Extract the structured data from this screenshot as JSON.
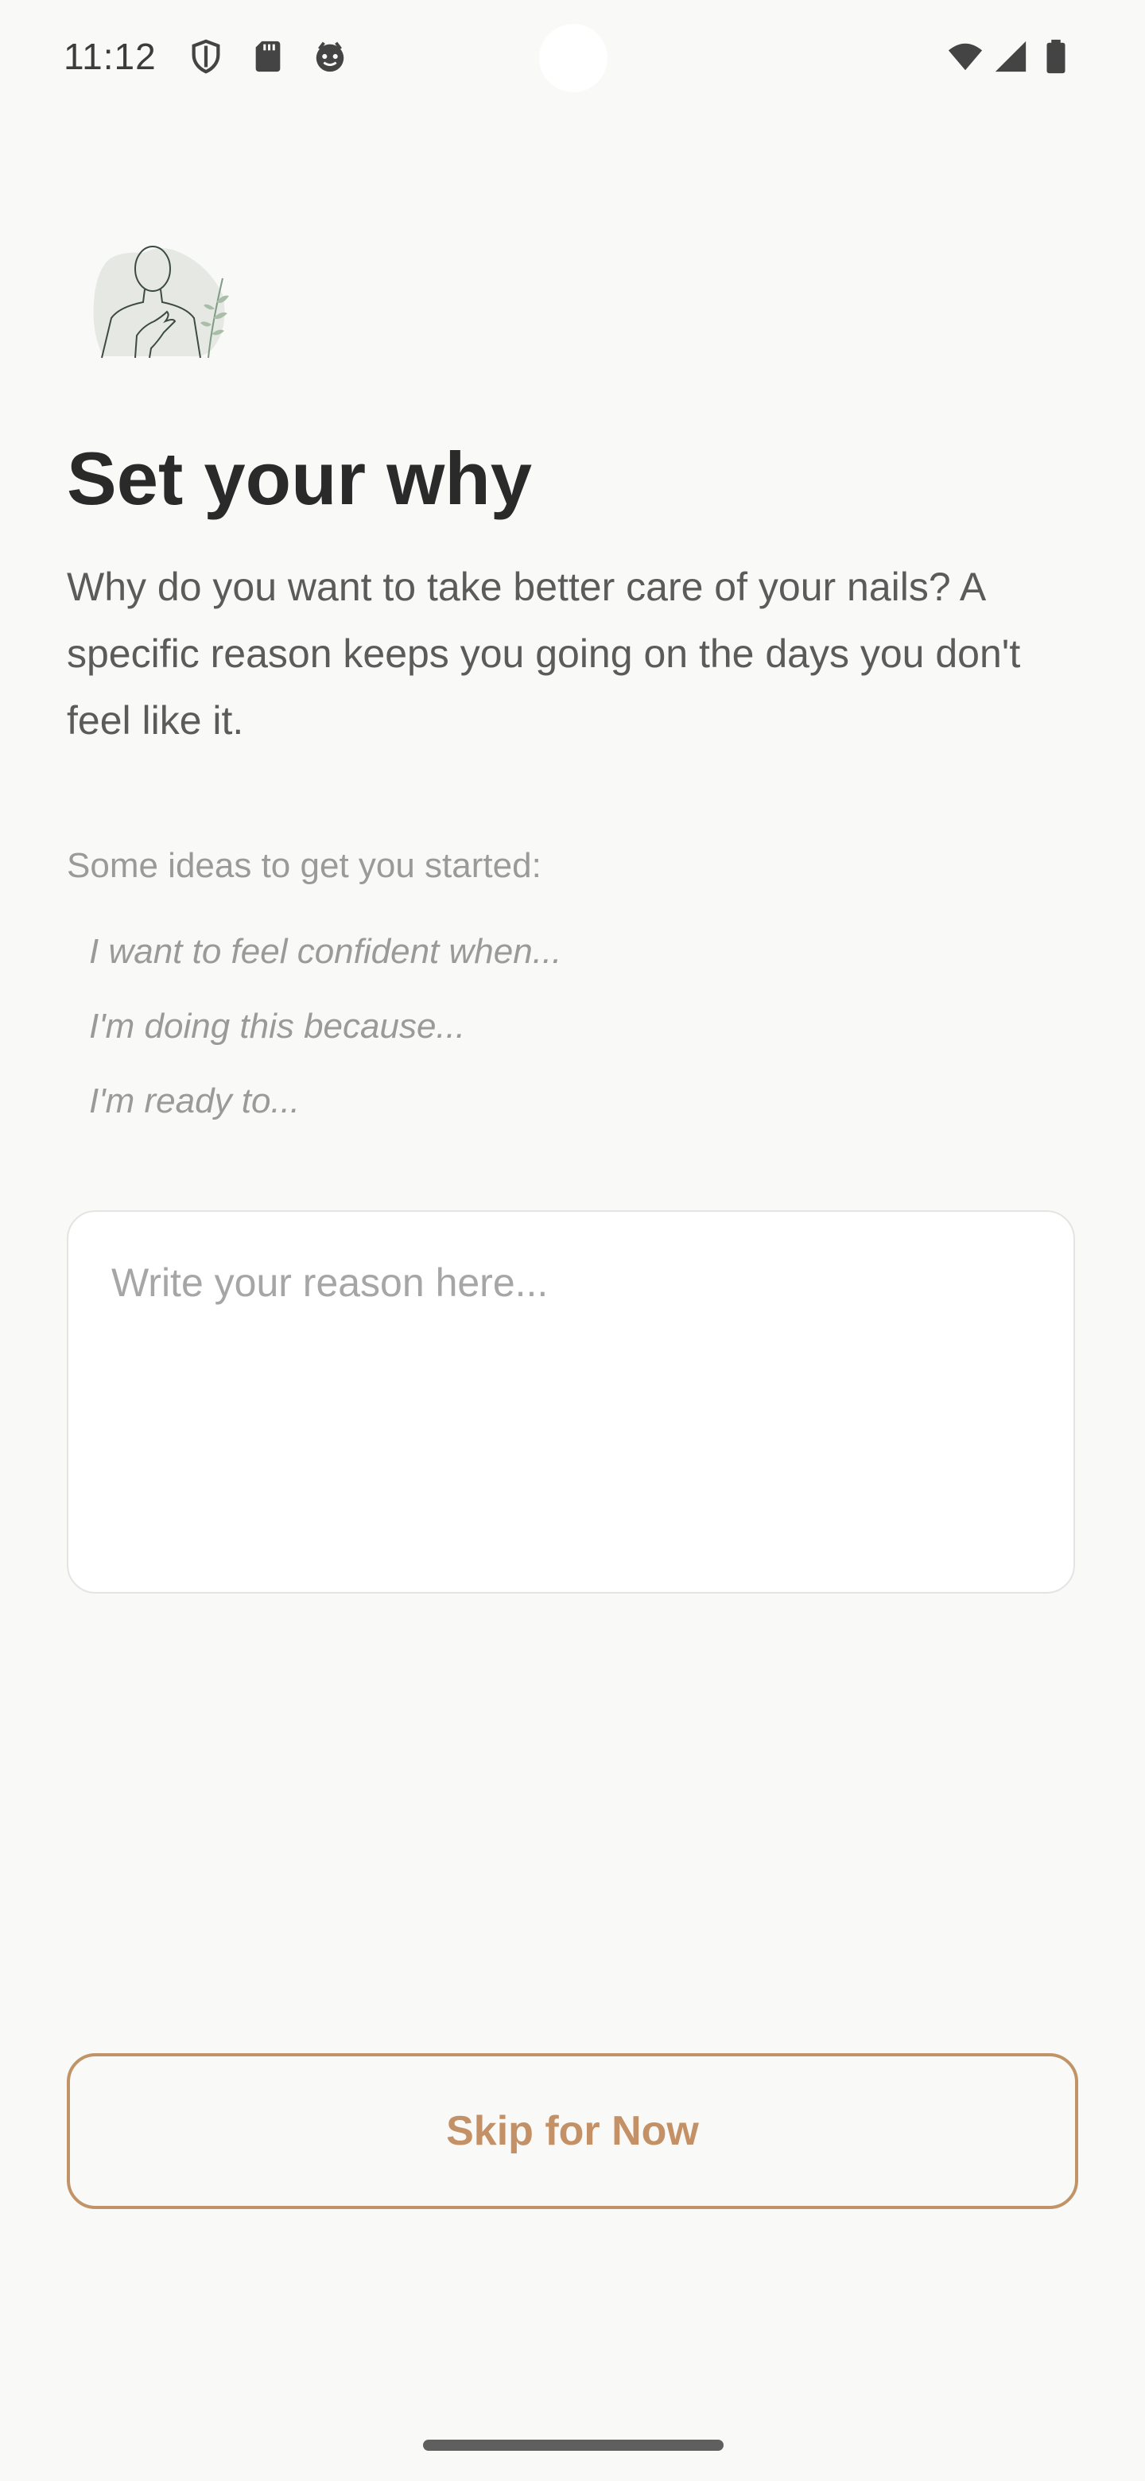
{
  "status_bar": {
    "time": "11:12",
    "icons": [
      "shield-icon",
      "sd-card-icon",
      "face-icon",
      "wifi-icon",
      "signal-icon",
      "battery-icon"
    ]
  },
  "header": {
    "illustration": "person-hand-on-heart-icon",
    "title": "Set your why",
    "subtitle": "Why do you want to take better care of your nails? A specific reason keeps you going on the days you don't feel like it."
  },
  "ideas": {
    "heading": "Some ideas to get you started:",
    "items": [
      "I want to feel confident when...",
      "I'm doing this because...",
      "I'm ready to..."
    ]
  },
  "reason_input": {
    "value": "",
    "placeholder": "Write your reason here..."
  },
  "actions": {
    "skip_label": "Skip for Now"
  },
  "colors": {
    "background": "#f9f9f7",
    "accent": "#c49066",
    "title": "#2a2a2a",
    "muted": "#9a9a9a"
  }
}
